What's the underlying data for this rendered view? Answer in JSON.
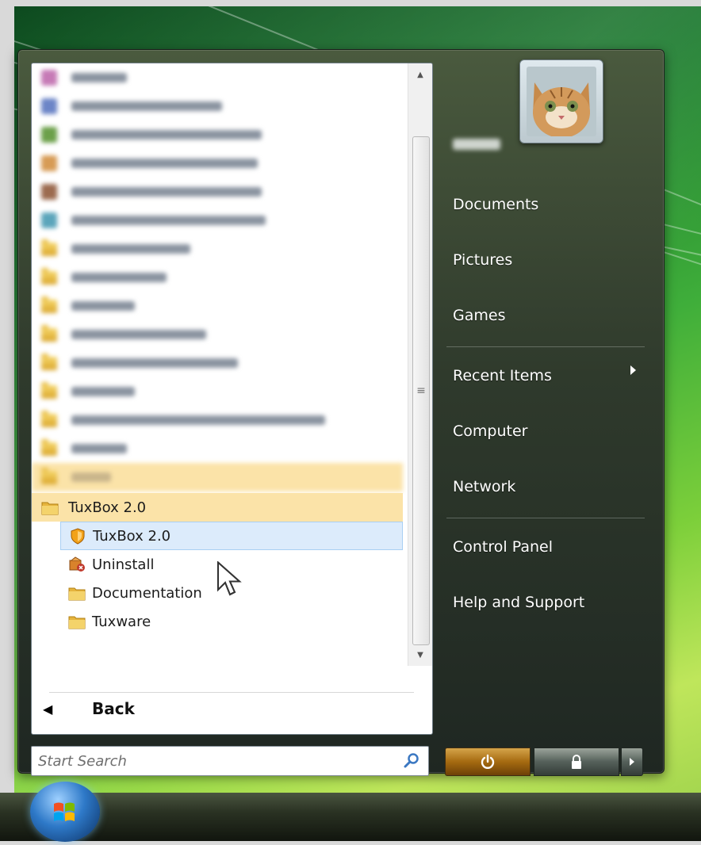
{
  "user": {
    "name": "",
    "picture_alt": "cat"
  },
  "programs_blurred_count": 15,
  "programs": [
    {
      "label": "TuxBox 2.0",
      "type": "folder",
      "highlight": "folder",
      "icon": "folder-icon"
    },
    {
      "label": "TuxBox 2.0",
      "type": "app",
      "highlight": "selected",
      "icon": "tuxbox-shield-icon"
    },
    {
      "label": "Uninstall",
      "type": "app",
      "icon": "uninstall-icon"
    },
    {
      "label": "Documentation",
      "type": "folder",
      "icon": "folder-icon"
    },
    {
      "label": "Tuxware",
      "type": "folder",
      "icon": "folder-icon"
    }
  ],
  "back": {
    "label": "Back"
  },
  "search": {
    "placeholder": "Start Search"
  },
  "right_menu": [
    {
      "label": "Documents"
    },
    {
      "label": "Pictures"
    },
    {
      "label": "Games"
    },
    {
      "label": "Recent Items"
    },
    {
      "label": "Computer"
    },
    {
      "label": "Network"
    },
    {
      "label": "Control Panel"
    },
    {
      "label": "Help and Support"
    }
  ],
  "colors": {
    "accent": "#dcebfb",
    "folder_highlight": "#fbe3a8"
  }
}
